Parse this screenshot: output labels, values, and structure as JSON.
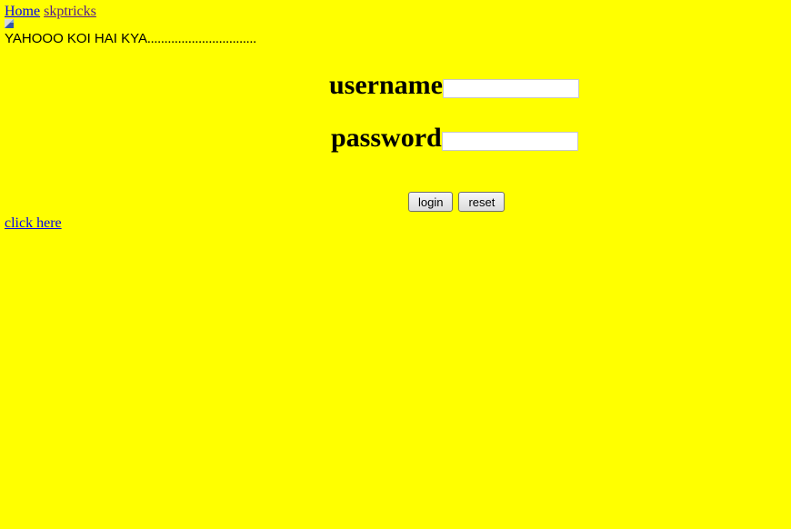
{
  "nav": {
    "home_label": "Home",
    "skptricks_label": "skptricks"
  },
  "broken_image": {
    "icon": "broken-image-icon"
  },
  "marquee": {
    "text": "YAHOOO KOI HAI KYA",
    "dots": "................................"
  },
  "form": {
    "username_label": "username",
    "username_value": "",
    "password_label": "password",
    "password_value": "",
    "login_label": "login",
    "reset_label": "reset"
  },
  "footer": {
    "click_here_label": "click here"
  },
  "colors": {
    "background": "#ffff00",
    "link": "#0000ee",
    "visited_link": "#551a8b"
  }
}
